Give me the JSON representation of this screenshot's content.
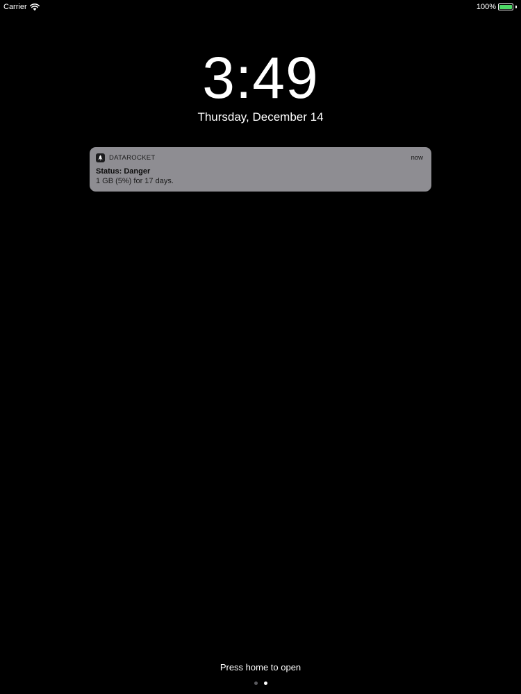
{
  "status_bar": {
    "carrier": "Carrier",
    "battery_percent": "100%",
    "battery_level": 1.0,
    "battery_color": "#4cd964",
    "icons": [
      "wifi-icon",
      "battery-icon"
    ]
  },
  "lock_screen": {
    "time": "3:49",
    "date": "Thursday, December 14"
  },
  "notification": {
    "app_name": "DATAROCKET",
    "time": "now",
    "title": "Status: Danger",
    "body": "1 GB (5%) for 17 days.",
    "icon": "rocket-icon",
    "background_color": "#8e8d92"
  },
  "bottom": {
    "hint": "Press home to open",
    "page_count": 2,
    "active_page": 2
  }
}
